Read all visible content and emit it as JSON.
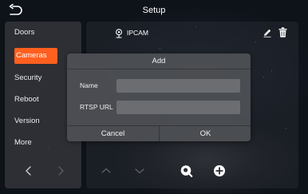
{
  "header": {
    "title": "Setup",
    "back_icon": "back-arrow-icon"
  },
  "sidebar": {
    "items": [
      {
        "label": "Doors"
      },
      {
        "label": "Cameras",
        "active": true
      },
      {
        "label": "Security"
      },
      {
        "label": "Reboot"
      },
      {
        "label": "Version"
      },
      {
        "label": "More"
      }
    ],
    "prev_icon": "chevron-left-icon",
    "next_icon": "chevron-right-icon"
  },
  "camera_list": {
    "items": [
      {
        "name": "IPCAM",
        "icon": "camera-icon"
      }
    ],
    "edit_icon": "pencil-icon",
    "delete_icon": "trash-icon"
  },
  "toolbar": {
    "up_icon": "chevron-up-icon",
    "down_icon": "chevron-down-icon",
    "search_icon": "search-icon",
    "add_icon": "add-icon"
  },
  "dialog": {
    "title": "Add",
    "name_label": "Name",
    "name_value": "",
    "rtsp_label": "RTSP URL",
    "rtsp_value": "",
    "cancel_label": "Cancel",
    "ok_label": "OK"
  },
  "colors": {
    "accent": "#ff5f1f",
    "panel": "#34363a",
    "dialog": "#4e5054"
  }
}
